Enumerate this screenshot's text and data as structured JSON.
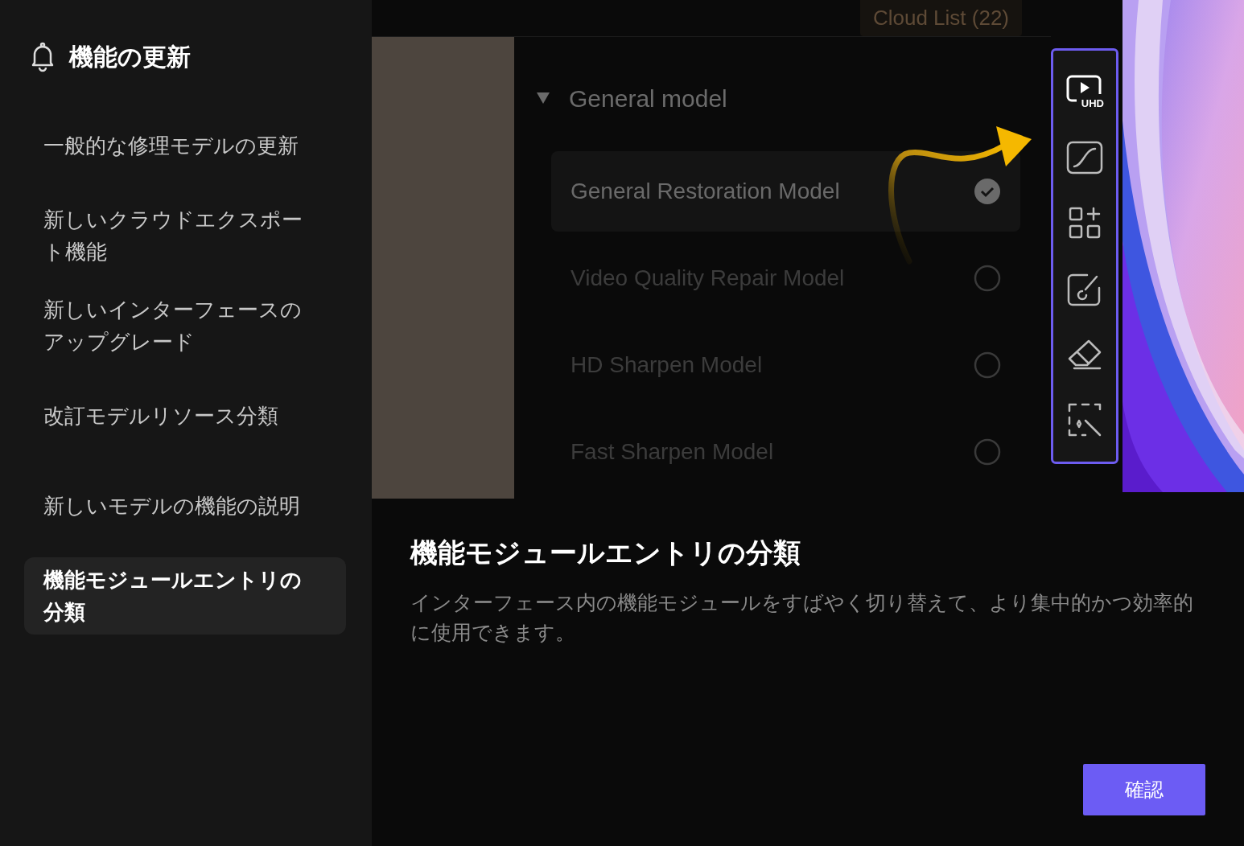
{
  "sidebar": {
    "title": "機能の更新",
    "items": [
      {
        "label": "一般的な修理モデルの更新",
        "selected": false
      },
      {
        "label": "新しいクラウドエクスポート機能",
        "selected": false
      },
      {
        "label": "新しいインターフェースのアップグレード",
        "selected": false
      },
      {
        "label": "改訂モデルリソース分類",
        "selected": false
      },
      {
        "label": "新しいモデルの機能の説明",
        "selected": false
      },
      {
        "label": "機能モジュールエントリの分類",
        "selected": true
      }
    ]
  },
  "preview": {
    "cloud_button": "Cloud List (22)",
    "group": {
      "label": "General model",
      "expanded": true
    },
    "models": [
      {
        "label": "General Restoration Model",
        "selected": true
      },
      {
        "label": "Video Quality Repair Model",
        "selected": false
      },
      {
        "label": "HD Sharpen Model",
        "selected": false
      },
      {
        "label": "Fast Sharpen Model",
        "selected": false
      }
    ],
    "toolbar": {
      "uhd_badge": "UHD"
    }
  },
  "content": {
    "title": "機能モジュールエントリの分類",
    "description": "インターフェース内の機能モジュールをすばやく切り替えて、より集中的かつ効率的に使用できます。"
  },
  "confirm_button": "確認"
}
